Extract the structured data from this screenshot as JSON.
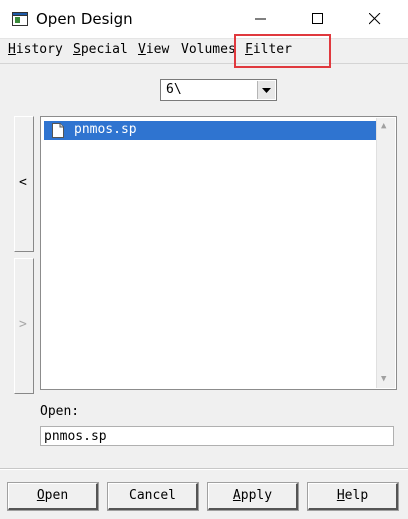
{
  "window": {
    "title": "Open Design"
  },
  "menu": {
    "items": [
      {
        "mnemonic": "H",
        "rest": "istory"
      },
      {
        "mnemonic": "S",
        "rest": "pecial"
      },
      {
        "mnemonic": "V",
        "rest": "iew"
      },
      {
        "mnemonic": "V",
        "rest": "olumes"
      },
      {
        "mnemonic": "F",
        "rest": "ilter"
      }
    ]
  },
  "annotation": {
    "highlight_color": "#e0393e"
  },
  "path_select": {
    "value": "6\\"
  },
  "side_buttons": {
    "prev_glyph": "<",
    "next_glyph": ">"
  },
  "file_list": {
    "items": [
      {
        "name": "pnmos.sp",
        "selected": true,
        "icon": "document-icon"
      }
    ],
    "selection_color": "#2f74d0"
  },
  "open_field": {
    "label": "Open:",
    "value": "pnmos.sp"
  },
  "buttons": [
    {
      "mnemonic": "O",
      "rest": "pen"
    },
    {
      "mnemonic": "",
      "rest": "Cancel"
    },
    {
      "mnemonic": "A",
      "rest": "pply"
    },
    {
      "mnemonic": "H",
      "rest": "elp"
    }
  ]
}
